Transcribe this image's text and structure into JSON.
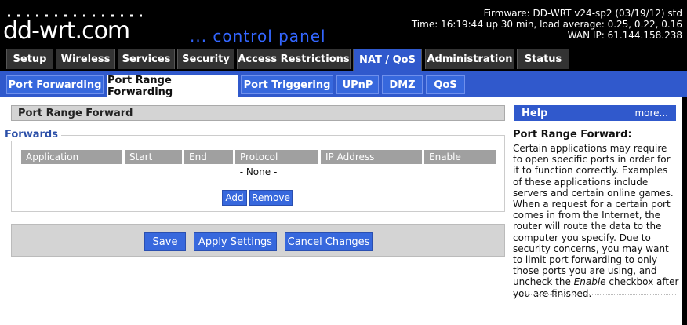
{
  "header": {
    "logo_text": "dd-wrt.com",
    "subtitle": "... control panel",
    "firmware": "Firmware: DD-WRT v24-sp2 (03/19/12) std",
    "time": "Time: 16:19:44 up 30 min, load average: 0.25, 0.22, 0.16",
    "wan_ip": "WAN IP: 61.144.158.238"
  },
  "main_tabs": [
    "Setup",
    "Wireless",
    "Services",
    "Security",
    "Access Restrictions",
    "NAT / QoS",
    "Administration",
    "Status"
  ],
  "sub_tabs": [
    "Port Forwarding",
    "Port Range Forwarding",
    "Port Triggering",
    "UPnP",
    "DMZ",
    "QoS"
  ],
  "page": {
    "title": "Port Range Forward",
    "legend": "Forwards",
    "columns": [
      "Application",
      "Start",
      "End",
      "Protocol",
      "IP Address",
      "Enable"
    ],
    "empty_text": "- None -",
    "add_label": "Add",
    "remove_label": "Remove"
  },
  "actions": {
    "save": "Save",
    "apply": "Apply Settings",
    "cancel": "Cancel Changes"
  },
  "help": {
    "header": "Help",
    "more": "more...",
    "title": "Port Range Forward:",
    "body_before": "Certain applications may require to open specific ports in order for it to function correctly. Examples of these applications include servers and certain online games. When a request for a certain port comes in from the Internet, the router will route the data to the computer you specify. Due to security concerns, you may want to limit port forwarding to only those ports you are using, and uncheck the ",
    "body_em": "Enable",
    "body_after": " checkbox after you are finished."
  },
  "colors": {
    "accent": "#3059cc",
    "tab_dark": "#333333",
    "header_gray": "#a0a0a0"
  }
}
